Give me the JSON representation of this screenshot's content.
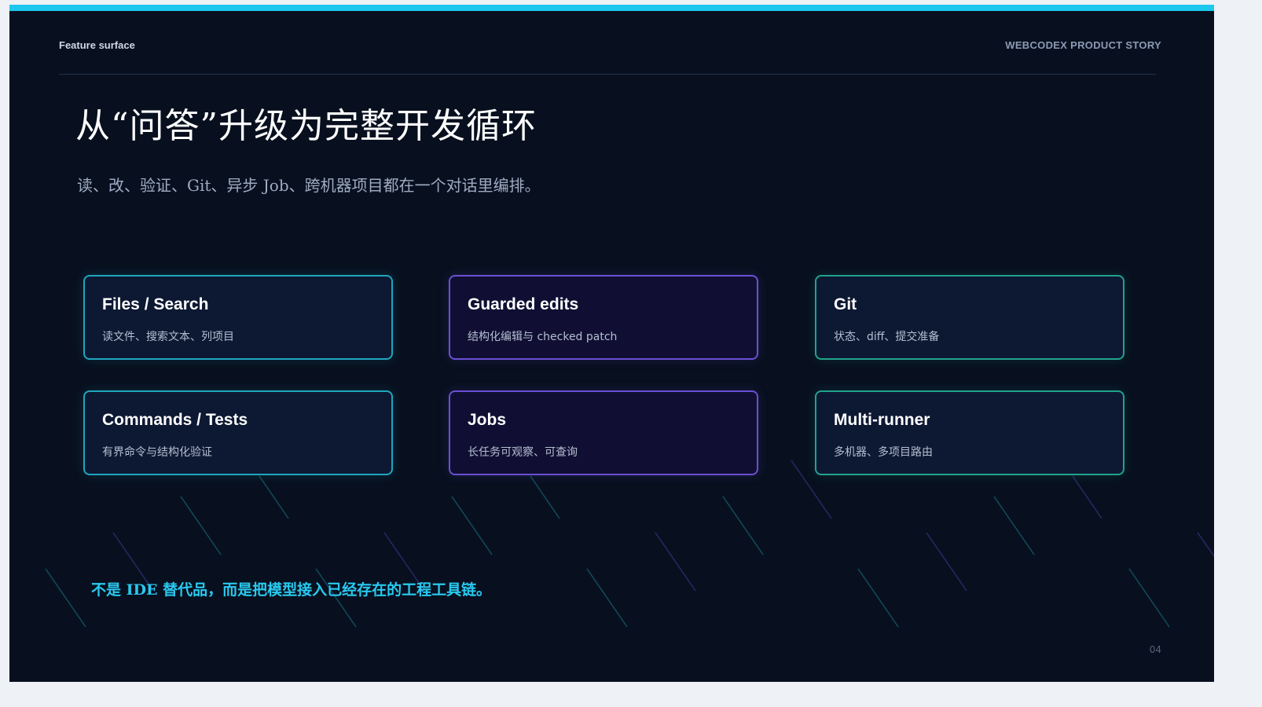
{
  "header": {
    "kicker": "Feature surface",
    "brand": "WEBCODEX PRODUCT STORY"
  },
  "title": "从“问答”升级为完整开发循环",
  "subtitle": "读、改、验证、Git、异步 Job、跨机器项目都在一个对话里编排。",
  "cards": [
    {
      "title": "Files / Search",
      "desc": "读文件、搜索文本、列项目",
      "accent": "#1fa6bd"
    },
    {
      "title": "Guarded edits",
      "desc": "结构化编辑与 checked patch",
      "accent": "#6a4fd4"
    },
    {
      "title": "Git",
      "desc": "状态、diff、提交准备",
      "accent": "#21a38b"
    },
    {
      "title": "Commands / Tests",
      "desc": "有界命令与结构化验证",
      "accent": "#1fa6bd"
    },
    {
      "title": "Jobs",
      "desc": "长任务可观察、可查询",
      "accent": "#6a4fd4"
    },
    {
      "title": "Multi-runner",
      "desc": "多机器、多项目路由",
      "accent": "#21a38b"
    }
  ],
  "tagline": "不是 IDE 替代品，而是把模型接入已经存在的工程工具链。",
  "page_number": "04",
  "colors": {
    "background": "#08101f",
    "top_bar": "#1ec7ee",
    "tagline": "#29c9ef"
  }
}
